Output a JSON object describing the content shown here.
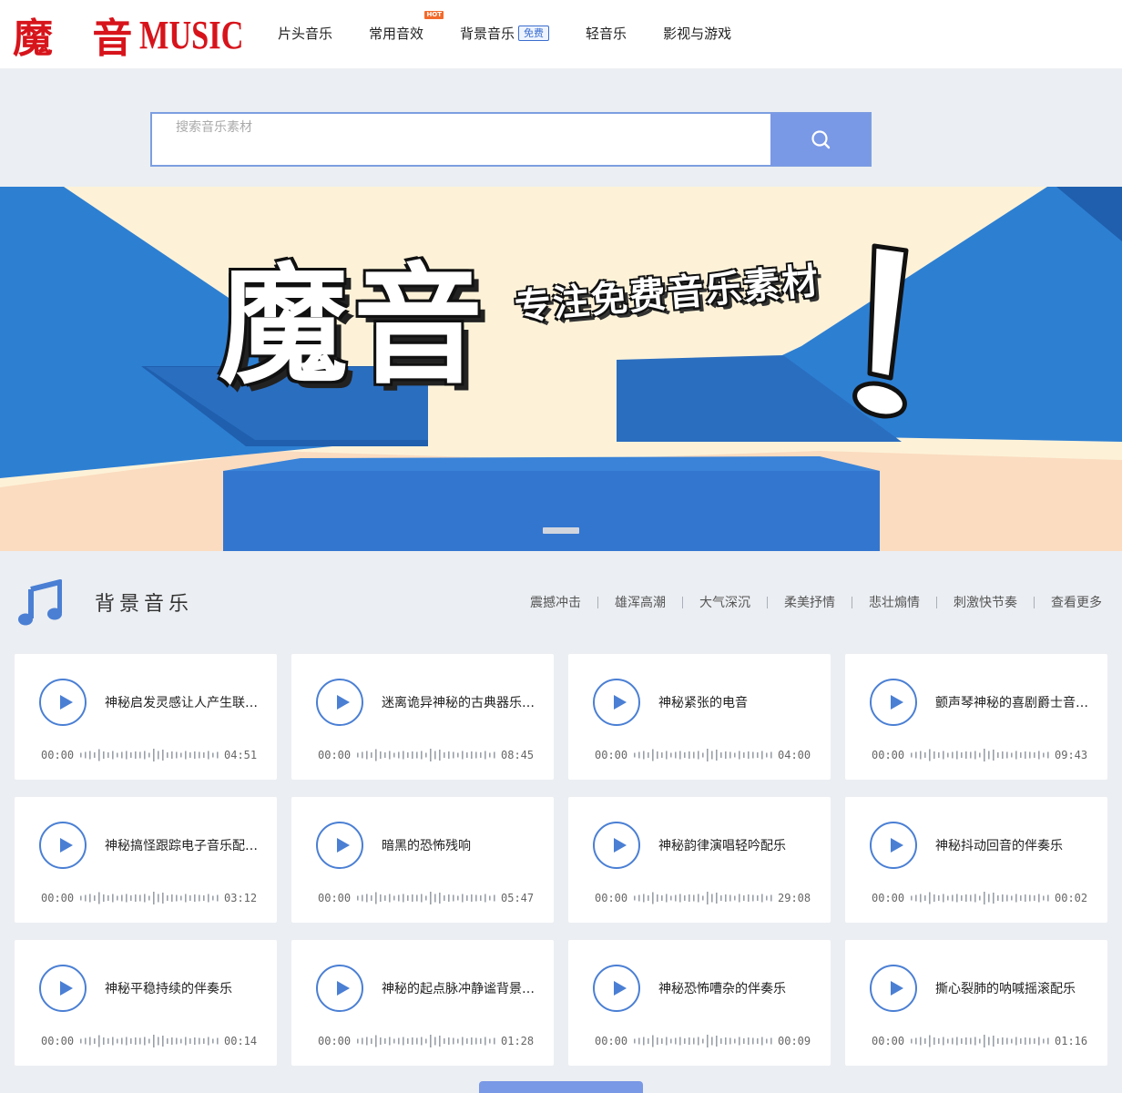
{
  "header": {
    "logo_cn": "魔 音",
    "logo_en": "MUSIC",
    "nav": [
      {
        "label": "片头音乐"
      },
      {
        "label": "常用音效",
        "badge": "HOT"
      },
      {
        "label": "背景音乐",
        "badge": "免费"
      },
      {
        "label": "轻音乐"
      },
      {
        "label": "影视与游戏"
      }
    ]
  },
  "search": {
    "placeholder": "搜索音乐素材",
    "icon": "search-icon"
  },
  "banner": {
    "title": "魔音",
    "slogan": "专注免费音乐素材",
    "exclaim": "!",
    "colors": {
      "sky": "#fdf2d8",
      "blue": "#2d7fd2",
      "blue_dark": "#1f5fae",
      "stage": "#3376d0",
      "floor": "#fbdcc0"
    }
  },
  "section": {
    "title": "背景音乐",
    "icon": "music-note-icon",
    "tags": [
      "震撼冲击",
      "雄浑高潮",
      "大气深沉",
      "柔美抒情",
      "悲壮煽情",
      "刺激快节奏",
      "查看更多"
    ]
  },
  "tracks": [
    {
      "title": "神秘启发灵感让人产生联想的配乐",
      "current": "00:00",
      "duration": "04:51"
    },
    {
      "title": "迷离诡异神秘的古典器乐配乐",
      "current": "00:00",
      "duration": "08:45"
    },
    {
      "title": "神秘紧张的电音",
      "current": "00:00",
      "duration": "04:00"
    },
    {
      "title": "颤声琴神秘的喜剧爵士音乐配乐",
      "current": "00:00",
      "duration": "09:43"
    },
    {
      "title": "神秘搞怪跟踪电子音乐配乐素材",
      "current": "00:00",
      "duration": "03:12"
    },
    {
      "title": "暗黑的恐怖残响",
      "current": "00:00",
      "duration": "05:47"
    },
    {
      "title": "神秘韵律演唱轻吟配乐",
      "current": "00:00",
      "duration": "29:08"
    },
    {
      "title": "神秘抖动回音的伴奏乐",
      "current": "00:00",
      "duration": "00:02"
    },
    {
      "title": "神秘平稳持续的伴奏乐",
      "current": "00:00",
      "duration": "00:14"
    },
    {
      "title": "神秘的起点脉冲静谧背景音乐",
      "current": "00:00",
      "duration": "01:28"
    },
    {
      "title": "神秘恐怖嘈杂的伴奏乐",
      "current": "00:00",
      "duration": "00:09"
    },
    {
      "title": "撕心裂肺的呐喊摇滚配乐",
      "current": "00:00",
      "duration": "01:16"
    }
  ],
  "colors": {
    "accent": "#7998e6",
    "play": "#4a7fd4",
    "brand": "#d7141b",
    "hot": "#f36a2b"
  }
}
